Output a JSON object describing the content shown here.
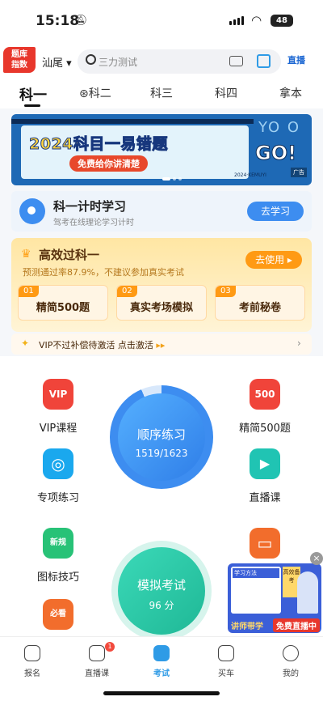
{
  "status": {
    "time": "15:18",
    "battery": "48"
  },
  "header": {
    "logo_line1": "题库",
    "logo_line2": "指数",
    "city": "汕尾",
    "search_placeholder": "三力测试",
    "live_label": "直播"
  },
  "tabs": [
    "科一",
    "科二",
    "科三",
    "科四",
    "拿本"
  ],
  "banner": {
    "title": "2024科目一易错题",
    "subtitle": "免费给你讲清楚",
    "go": "GO!",
    "code": "2024·KEMUYI",
    "ad_tag": "广告"
  },
  "timer": {
    "title": "科一计时学习",
    "subtitle": "驾考在线理论学习计时",
    "button": "去学习"
  },
  "vip": {
    "title": "高效过科一",
    "desc": "预测通过率87.9%，不建议参加真实考试",
    "button": "去使用 ▸",
    "cards": [
      {
        "num": "01",
        "label": "精简500题"
      },
      {
        "num": "02",
        "label": "真实考场模拟"
      },
      {
        "num": "03",
        "label": "考前秘卷"
      }
    ]
  },
  "vip_bar": {
    "text": "VIP不过补偿待激活 点击激活",
    "arrow": "›"
  },
  "features_left": [
    {
      "label": "VIP课程",
      "icon": "vip-course-icon",
      "glyph": "VIP",
      "color": "#f0443a"
    },
    {
      "label": "专项练习",
      "icon": "target-icon",
      "glyph": "◎",
      "color": "#1aa8ee"
    },
    {
      "label": "图标技巧",
      "icon": "sign-tips-icon",
      "glyph": "新规",
      "color": "#28c277"
    },
    {
      "label": "必看",
      "icon": "must-see-icon",
      "glyph": "必看",
      "color": "#f26d2c"
    }
  ],
  "features_right": [
    {
      "label": "精简500题",
      "icon": "simplified-500-icon",
      "glyph": "500",
      "color": "#f0443a"
    },
    {
      "label": "直播课",
      "icon": "live-class-icon",
      "glyph": "▶",
      "color": "#20c4b3"
    },
    {
      "label": "",
      "icon": "tv-icon",
      "glyph": "▭",
      "color": "#f26d2c"
    }
  ],
  "practice": {
    "title": "顺序练习",
    "progress": "1519/1623",
    "done": 1519,
    "total": 1623
  },
  "exam": {
    "title": "模拟考试",
    "score": "96 分"
  },
  "ad": {
    "title": "学习方法",
    "gold": "高效备考",
    "left": "讲师带学",
    "right": "免费直播中",
    "close": "×"
  },
  "nav": [
    {
      "label": "报名",
      "badge": ""
    },
    {
      "label": "直播课",
      "badge": "1"
    },
    {
      "label": "考试",
      "badge": ""
    },
    {
      "label": "买车",
      "badge": ""
    },
    {
      "label": "我的",
      "badge": ""
    }
  ],
  "colors": {
    "accent": "#2f9be6",
    "practice": "#3d8df0",
    "exam": "#27c8a6",
    "vip": "#ff9a14"
  }
}
